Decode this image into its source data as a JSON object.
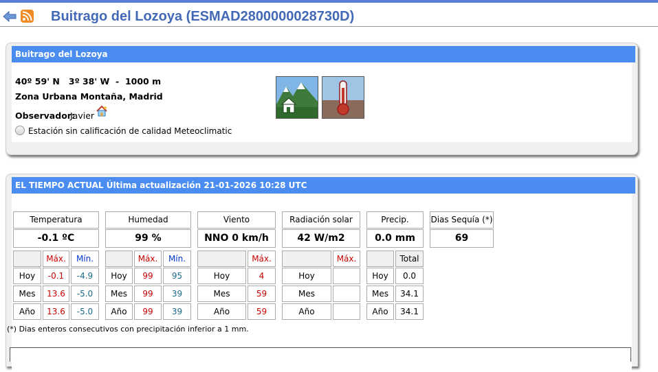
{
  "header": {
    "title": "Buitrago del Lozoya (ESMAD2800000028730D)"
  },
  "station": {
    "panel_title": "Buitrago del Lozoya",
    "coords": "40º 59' N   3º 38' W  -  1000 m",
    "zone": "Zona Urbana Montaña, Madrid",
    "observer_label": "Observador:",
    "observer_name": "Javier",
    "quality": "Estación sin calificación de calidad Meteoclimatic"
  },
  "current": {
    "panel_title": "EL TIEMPO ACTUAL Última actualización 21-01-2026 10:28 UTC",
    "temperature": {
      "label": "Temperatura",
      "value": "-0.1 ºC",
      "max_label": "Máx.",
      "min_label": "Mín.",
      "rows": [
        {
          "period": "Hoy",
          "max": "-0.1",
          "min": "-4.9"
        },
        {
          "period": "Mes",
          "max": "13.6",
          "min": "-5.0"
        },
        {
          "period": "Año",
          "max": "13.6",
          "min": "-5.0"
        }
      ]
    },
    "humidity": {
      "label": "Humedad",
      "value": "99 %",
      "max_label": "Máx.",
      "min_label": "Mín.",
      "rows": [
        {
          "period": "Hoy",
          "max": "99",
          "min": "95"
        },
        {
          "period": "Mes",
          "max": "99",
          "min": "39"
        },
        {
          "period": "Año",
          "max": "99",
          "min": "39"
        }
      ]
    },
    "wind": {
      "label": "Viento",
      "value": "NNO  0 km/h",
      "max_label": "Máx.",
      "rows": [
        {
          "period": "Hoy",
          "max": "4"
        },
        {
          "period": "Mes",
          "max": "59"
        },
        {
          "period": "Año",
          "max": "59"
        }
      ]
    },
    "radiation": {
      "label": "Radiación solar",
      "value": "42 W/m2",
      "max_label": "Máx.",
      "rows": [
        {
          "period": "Hoy",
          "max": ""
        },
        {
          "period": "Mes",
          "max": ""
        },
        {
          "period": "Año",
          "max": ""
        }
      ]
    },
    "precip": {
      "label": "Precip.",
      "value": "0.0 mm",
      "total_label": "Total",
      "rows": [
        {
          "period": "Hoy",
          "total": "0.0"
        },
        {
          "period": "Mes",
          "total": "34.1"
        },
        {
          "period": "Año",
          "total": "34.1"
        }
      ]
    },
    "drought": {
      "label": "Dias Sequía (*)",
      "value": "69"
    },
    "footnote": "(*) Dias enteros consecutivos con precipitación inferior a 1 mm."
  },
  "colors": {
    "accent": "#4b8cf1",
    "title": "#4268b6",
    "max": "#cc0000",
    "min": "#0033cc"
  }
}
